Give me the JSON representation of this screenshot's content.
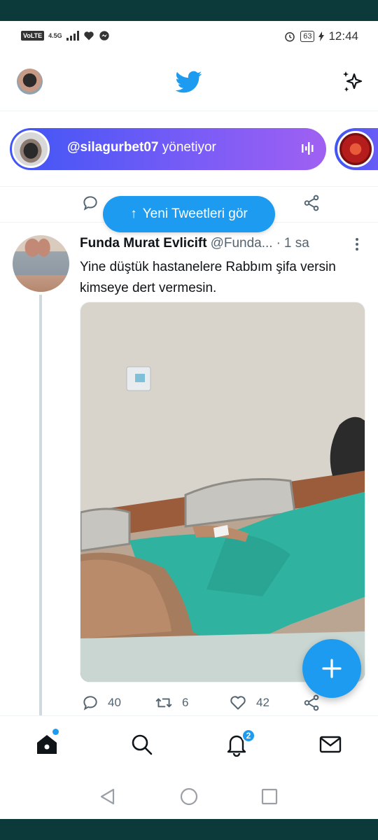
{
  "status_bar": {
    "volte": "VoLTE",
    "network": "4.5G",
    "battery": "63",
    "time": "12:44"
  },
  "app": {
    "brand_color": "#1d9bf0",
    "icons": [
      "profile-avatar",
      "twitter-bird-icon",
      "sparkle-icon"
    ]
  },
  "spaces": {
    "host_handle": "@silagurbet07",
    "host_suffix": "yönetiyor",
    "gradient": [
      "#3f56f5",
      "#a060f2"
    ]
  },
  "new_tweets_button": {
    "arrow": "↑",
    "label": "Yeni Tweetleri gör"
  },
  "tweet": {
    "author_name": "Funda Murat Evlicift",
    "author_handle": "@Funda...",
    "separator": "·",
    "time_ago": "1 sa",
    "text": "Yine düştük hastanelere Rabbım şifa versin kimseye dert vermesin.",
    "media": "hospital-bed-photo",
    "replies": "40",
    "retweets": "6",
    "likes": "42"
  },
  "tab_bar": {
    "tabs": [
      "home",
      "search",
      "notifications",
      "messages"
    ],
    "notifications_badge": "2"
  },
  "system_nav": [
    "back",
    "home",
    "recents"
  ]
}
